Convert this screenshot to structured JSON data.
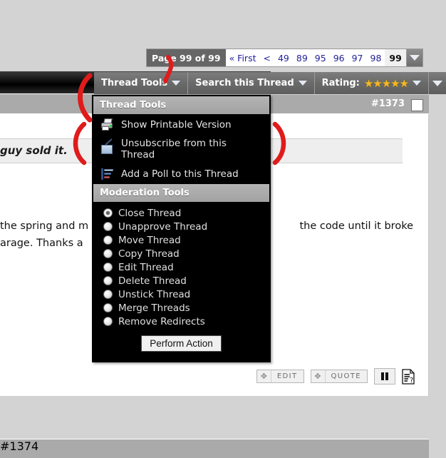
{
  "pagenav": {
    "current_page_label": "Page 99 of 99",
    "first_label": "« First",
    "prev_label": "<",
    "pages": [
      "49",
      "89",
      "95",
      "96",
      "97",
      "98"
    ],
    "active_page": "99"
  },
  "toolbar": {
    "thread_tools": "Thread Tools",
    "search_thread": "Search this Thread",
    "rating_label": "Rating:",
    "rating_stars": "★★★★★",
    "rating_value": 5
  },
  "menu": {
    "title": "Thread Tools",
    "items": [
      {
        "label": "Show Printable Version",
        "icon": "printer-icon"
      },
      {
        "label": "Unsubscribe from this Thread",
        "icon": "mail-unsubscribe-icon"
      },
      {
        "label": "Add a Poll to this Thread",
        "icon": "poll-icon"
      }
    ],
    "moderation_title": "Moderation Tools",
    "moderation_options": [
      {
        "label": "Close Thread",
        "selected": true
      },
      {
        "label": "Unapprove Thread",
        "selected": false
      },
      {
        "label": "Move Thread",
        "selected": false
      },
      {
        "label": "Copy Thread",
        "selected": false
      },
      {
        "label": "Edit Thread",
        "selected": false
      },
      {
        "label": "Delete Thread",
        "selected": false
      },
      {
        "label": "Unstick Thread",
        "selected": false
      },
      {
        "label": "Merge Threads",
        "selected": false
      },
      {
        "label": "Remove Redirects",
        "selected": false
      }
    ],
    "perform_action_label": "Perform Action"
  },
  "post": {
    "number": "#1373",
    "quote_text": "guy sold it.",
    "body_line1_left": "the spring and m",
    "body_line1_right": "the code until it broke",
    "body_line2_left": "arage. Thanks a",
    "edit_label": "EDIT",
    "quote_label": "QUOTE"
  },
  "next_post": {
    "number": "#1374"
  },
  "colors": {
    "page_background": "#d3d3d3",
    "toolbar_gray": "#6a6a6a",
    "menu_black": "#000000",
    "menu_header_gray": "#aaaaaa",
    "post_header_gray": "#aaaaaa",
    "link_blue": "#22229c",
    "star_gold": "#f5b820",
    "annotation_red": "#e01b1b"
  }
}
